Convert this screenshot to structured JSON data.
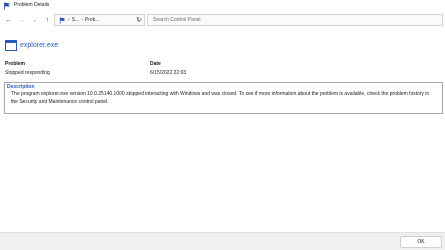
{
  "window": {
    "title": "Problem Details",
    "title_icon": "flag-icon"
  },
  "nav": {
    "back_icon": "←",
    "forward_icon": "→",
    "recent_icon": "⌄",
    "up_icon": "↑",
    "refresh_icon": "↻",
    "address": {
      "crumb1": "S...",
      "crumb2": "Prob...",
      "separator": "›",
      "dropdown_icon": "⌄"
    },
    "search_placeholder": "Search Control Panel"
  },
  "problem": {
    "app_name": "explorer.exe",
    "problem_header": "Problem",
    "date_header": "Date",
    "problem_value": "Stopped responding",
    "date_value": "6/15/2022 22:03",
    "description_label": "Description",
    "description_text": "The program explorer.exe version 10.0.25140.1000 stopped interacting with Windows and was closed. To see if more information about the problem is available, check the problem history in the Security and Maintenance control panel."
  },
  "footer": {
    "ok_label": "OK"
  },
  "colors": {
    "accent_blue": "#2a5bb5",
    "flag_blue": "#1f4fb0"
  }
}
